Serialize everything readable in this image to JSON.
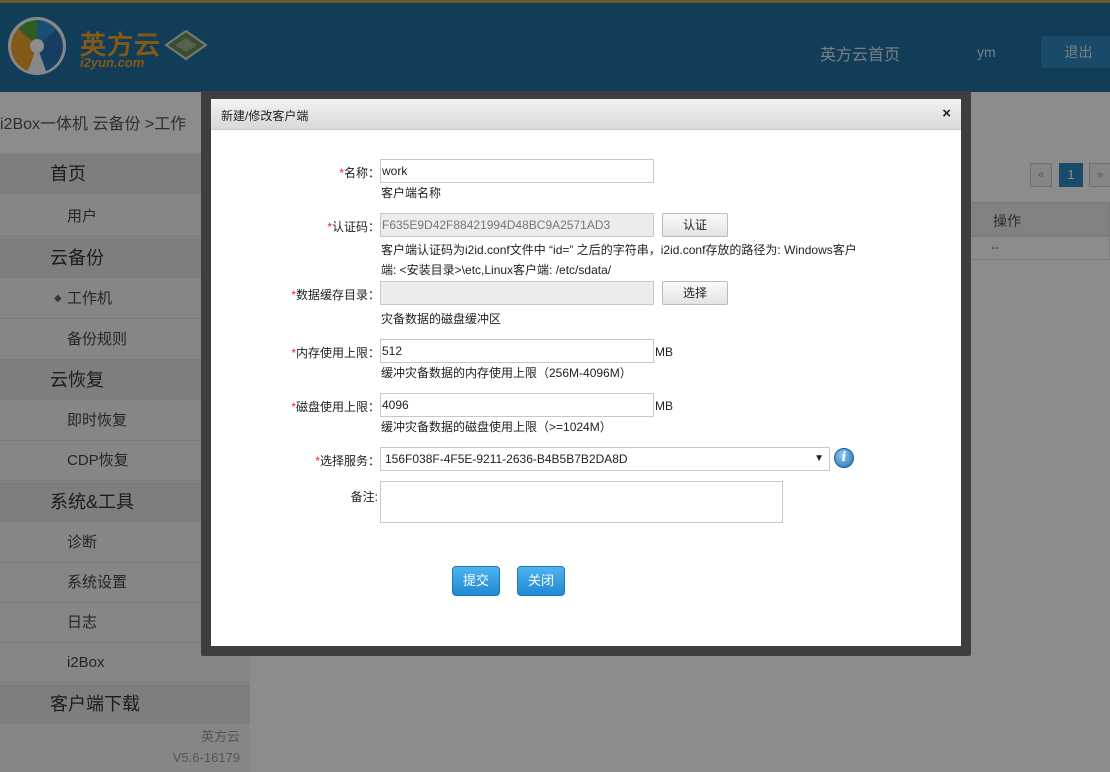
{
  "header": {
    "brand_name": "英方云",
    "brand_domain": "i2yun.com",
    "nav_home": "英方云首页",
    "nav_user": "ym",
    "nav_logout": "退出"
  },
  "breadcrumb": "i2Box一体机 云备份 >工作",
  "sidebar": {
    "items": [
      {
        "label": "首页",
        "level": "top"
      },
      {
        "label": "用户",
        "level": "sub"
      },
      {
        "label": "云备份",
        "level": "top"
      },
      {
        "label": "工作机",
        "level": "sub",
        "active": true
      },
      {
        "label": "备份规则",
        "level": "sub"
      },
      {
        "label": "云恢复",
        "level": "top"
      },
      {
        "label": "即时恢复",
        "level": "sub"
      },
      {
        "label": "CDP恢复",
        "level": "sub"
      },
      {
        "label": "系统&工具",
        "level": "top"
      },
      {
        "label": "诊断",
        "level": "sub"
      },
      {
        "label": "系统设置",
        "level": "sub"
      },
      {
        "label": "日志",
        "level": "sub"
      },
      {
        "label": "i2Box",
        "level": "sub"
      },
      {
        "label": "客户端下载",
        "level": "top"
      }
    ],
    "footer_name": "英方云",
    "footer_version": "V5.6-16179"
  },
  "main": {
    "pager_prev": "«",
    "pager_current": "1",
    "pager_next": "»",
    "table_header_op": "操作",
    "table_row_op": "--"
  },
  "modal": {
    "title": "新建/修改客户端",
    "close": "×",
    "required_mark": "*",
    "name_label": "名称：",
    "name_value": "work",
    "name_hint": "客户端名称",
    "auth_label": "认证码：",
    "auth_value": "F635E9D42F88421994D48BC9A2571AD3",
    "auth_button": "认证",
    "auth_hint_1": "客户端认证码为i2id.conf文件中 “id=” 之后的字符串，i2id.conf存放的路径为: Windows客户",
    "auth_hint_2": "端: <安装目录>\\etc,Linux客户端: /etc/sdata/",
    "cache_label": "数据缓存目录：",
    "cache_value": "",
    "cache_button": "选择",
    "cache_hint": "灾备数据的磁盘缓冲区",
    "mem_label": "内存使用上限：",
    "mem_value": "512",
    "mem_unit": "MB",
    "mem_hint": "缓冲灾备数据的内存使用上限（256M-4096M）",
    "disk_label": "磁盘使用上限：",
    "disk_value": "4096",
    "disk_unit": "MB",
    "disk_hint": "缓冲灾备数据的磁盘使用上限（>=1024M）",
    "service_label": "选择服务：",
    "service_value": "156F038F-4F5E-9211-2636-B4B5B7B2DA8D",
    "info_icon": "i",
    "note_label": "备注:",
    "submit_button": "提交",
    "close_button": "关闭"
  },
  "colors": {
    "header_bg": "#1f6fa3",
    "accent_blue": "#2f88bf",
    "brand_orange": "#f0a32a",
    "required_red": "#ee2222"
  }
}
